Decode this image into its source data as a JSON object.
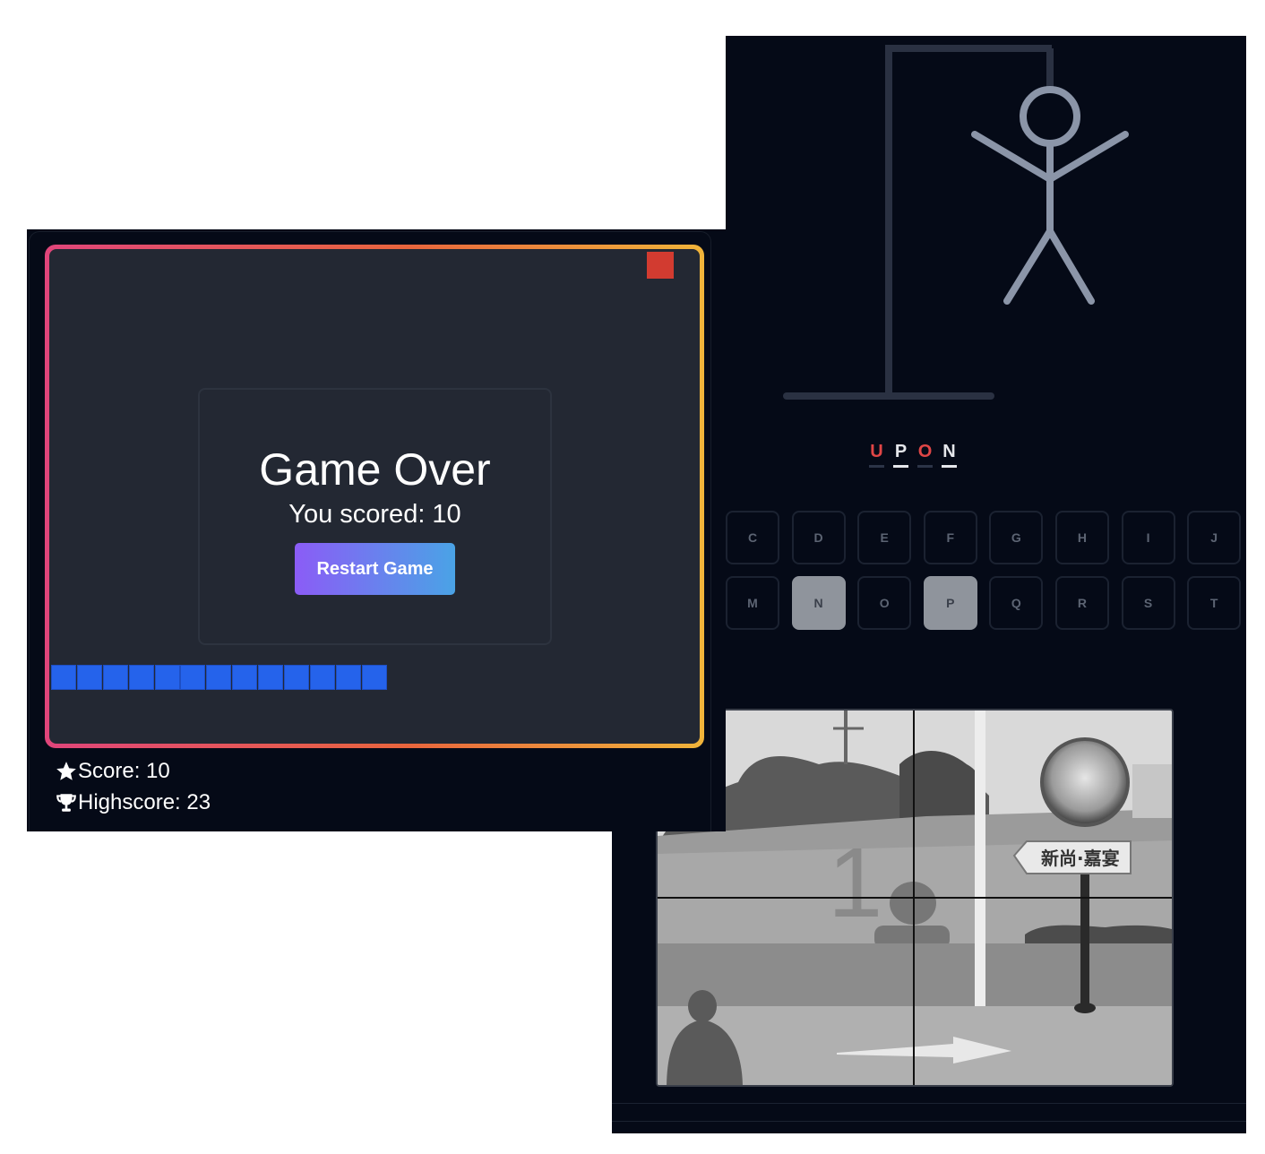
{
  "snake_game": {
    "game_over_title": "Game Over",
    "scored_text": "You scored: 10",
    "restart_label": "Restart Game",
    "score_text": "Score: 10",
    "highscore_text": "Highscore: 23",
    "snake_length": 13,
    "colors": {
      "border_start": "#e0457b",
      "border_end": "#f0b43a",
      "board": "#232833",
      "snake": "#2563eb",
      "food": "#d23b30",
      "button_start": "#8b5cf6",
      "button_end": "#4aa3e6"
    },
    "icons": {
      "score": "star-icon",
      "highscore": "trophy-icon"
    }
  },
  "hangman_game": {
    "word": [
      {
        "letter": "U",
        "state": "missed"
      },
      {
        "letter": "P",
        "state": "guessed"
      },
      {
        "letter": "O",
        "state": "missed"
      },
      {
        "letter": "N",
        "state": "guessed"
      }
    ],
    "keyboard": [
      {
        "label": "C",
        "used": false
      },
      {
        "label": "D",
        "used": false
      },
      {
        "label": "E",
        "used": false
      },
      {
        "label": "F",
        "used": false
      },
      {
        "label": "G",
        "used": false
      },
      {
        "label": "H",
        "used": false
      },
      {
        "label": "I",
        "used": false
      },
      {
        "label": "J",
        "used": false
      },
      {
        "label": "M",
        "used": false
      },
      {
        "label": "N",
        "used": true
      },
      {
        "label": "O",
        "used": false
      },
      {
        "label": "P",
        "used": true
      },
      {
        "label": "Q",
        "used": false
      },
      {
        "label": "R",
        "used": false
      },
      {
        "label": "S",
        "used": false
      },
      {
        "label": "T",
        "used": false
      }
    ],
    "photo_sign_text": "新尚·嘉宴"
  }
}
